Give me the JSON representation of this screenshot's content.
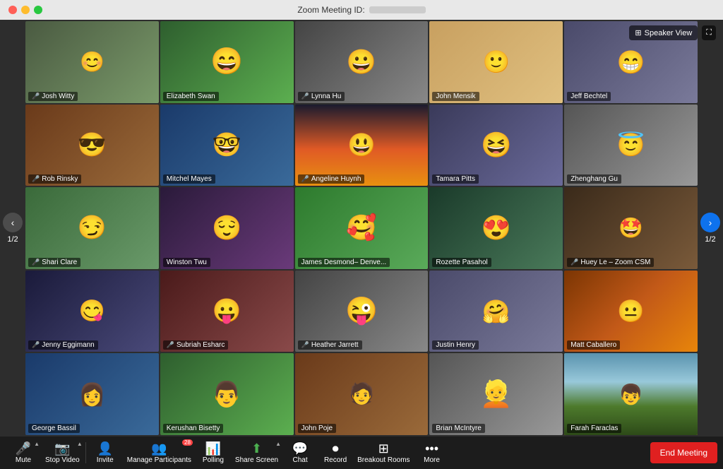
{
  "titlebar": {
    "title": "Zoom Meeting ID:",
    "buttons": {
      "close": "●",
      "minimize": "●",
      "maximize": "●"
    }
  },
  "topControls": {
    "speakerView": "Speaker View",
    "fullscreen": "⛶"
  },
  "navigation": {
    "leftLabel": "1/2",
    "rightLabel": "1/2"
  },
  "participants": [
    {
      "id": 1,
      "name": "Josh Witty",
      "bg": "bg-1",
      "muted": true
    },
    {
      "id": 2,
      "name": "Elizabeth Swan",
      "bg": "bg-2",
      "muted": false
    },
    {
      "id": 3,
      "name": "Lynna Hu",
      "bg": "bg-3",
      "muted": true
    },
    {
      "id": 4,
      "name": "John Mensik",
      "bg": "bg-4",
      "muted": false
    },
    {
      "id": 5,
      "name": "Jeff Bechtel",
      "bg": "bg-5",
      "muted": false
    },
    {
      "id": 6,
      "name": "Rob Rinsky",
      "bg": "bg-6",
      "muted": true
    },
    {
      "id": 7,
      "name": "Mitchel Mayes",
      "bg": "bg-7",
      "muted": false
    },
    {
      "id": 8,
      "name": "Angeline Huynh",
      "bg": "bg-sunset",
      "muted": true
    },
    {
      "id": 9,
      "name": "Tamara Pitts",
      "bg": "bg-8",
      "muted": false
    },
    {
      "id": 10,
      "name": "Zhenghang Gu",
      "bg": "bg-9",
      "muted": false
    },
    {
      "id": 11,
      "name": "Shari Clare",
      "bg": "bg-10",
      "muted": true
    },
    {
      "id": 12,
      "name": "Winston Twu",
      "bg": "bg-11",
      "muted": false
    },
    {
      "id": 13,
      "name": "James Desmond– Denve...",
      "bg": "bg-green",
      "muted": false
    },
    {
      "id": 14,
      "name": "Rozette Pasahol",
      "bg": "bg-12",
      "muted": false
    },
    {
      "id": 15,
      "name": "Huey Le – Zoom CSM",
      "bg": "bg-13",
      "muted": true
    },
    {
      "id": 16,
      "name": "Jenny Eggimann",
      "bg": "bg-14",
      "muted": true
    },
    {
      "id": 17,
      "name": "Subriah Esharc",
      "bg": "bg-15",
      "muted": true
    },
    {
      "id": 18,
      "name": "Heather Jarrett",
      "bg": "bg-3",
      "muted": true
    },
    {
      "id": 19,
      "name": "Justin Henry",
      "bg": "bg-5",
      "muted": false
    },
    {
      "id": 20,
      "name": "Matt Caballero",
      "bg": "bg-autumn",
      "muted": false
    },
    {
      "id": 21,
      "name": "George Bassil",
      "bg": "bg-7",
      "muted": false
    },
    {
      "id": 22,
      "name": "Kerushan Bisetty",
      "bg": "bg-2",
      "muted": false
    },
    {
      "id": 23,
      "name": "John Poje",
      "bg": "bg-6",
      "muted": false
    },
    {
      "id": 24,
      "name": "Brian McIntyre",
      "bg": "bg-9",
      "muted": false
    },
    {
      "id": 25,
      "name": "Farah Faraclas",
      "bg": "bg-mtn",
      "muted": false,
      "active": true
    }
  ],
  "toolbar": {
    "mute": {
      "label": "Mute",
      "icon": "🎤"
    },
    "stopVideo": {
      "label": "Stop Video",
      "icon": "📷"
    },
    "invite": {
      "label": "Invite",
      "icon": "👤"
    },
    "manageParticipants": {
      "label": "Manage Participants",
      "icon": "👥",
      "badge": "28"
    },
    "polling": {
      "label": "Polling",
      "icon": "📊"
    },
    "shareScreen": {
      "label": "Share Screen",
      "icon": "⬆"
    },
    "chat": {
      "label": "Chat",
      "icon": "💬"
    },
    "record": {
      "label": "Record",
      "icon": "⏺"
    },
    "breakoutRooms": {
      "label": "Breakout Rooms",
      "icon": "⊞"
    },
    "more": {
      "label": "More",
      "icon": "···"
    },
    "endMeeting": "End Meeting"
  }
}
